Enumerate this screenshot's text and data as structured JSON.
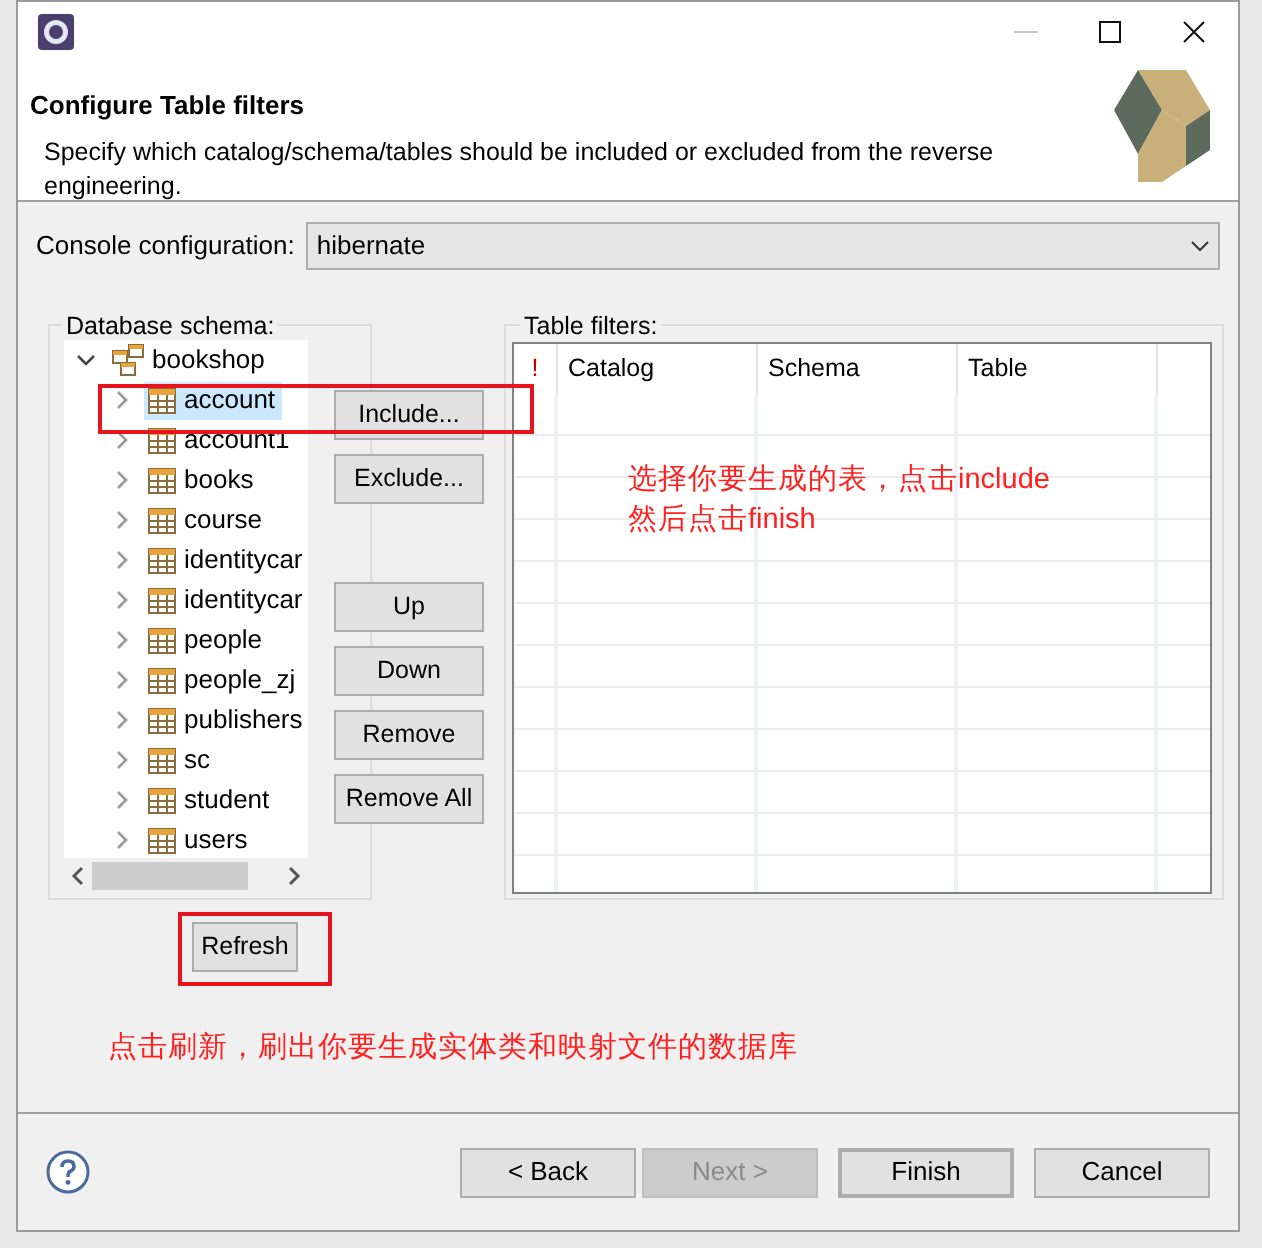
{
  "header": {
    "title": "Configure Table filters",
    "description": "Specify which catalog/schema/tables should be included or excluded from the reverse engineering."
  },
  "console_configuration": {
    "label": "Console configuration:",
    "value": "hibernate"
  },
  "database_schema": {
    "label": "Database schema:",
    "tree": [
      {
        "label": "bookshop",
        "kind": "schema",
        "expanded": true,
        "selected": false,
        "children": [
          {
            "label": "account",
            "kind": "table",
            "expanded": false,
            "selected": true
          },
          {
            "label": "account1",
            "kind": "table",
            "expanded": false,
            "selected": false
          },
          {
            "label": "books",
            "kind": "table",
            "expanded": false,
            "selected": false
          },
          {
            "label": "course",
            "kind": "table",
            "expanded": false,
            "selected": false
          },
          {
            "label": "identitycar",
            "kind": "table",
            "expanded": false,
            "selected": false
          },
          {
            "label": "identitycar",
            "kind": "table",
            "expanded": false,
            "selected": false
          },
          {
            "label": "people",
            "kind": "table",
            "expanded": false,
            "selected": false
          },
          {
            "label": "people_zj",
            "kind": "table",
            "expanded": false,
            "selected": false
          },
          {
            "label": "publishers",
            "kind": "table",
            "expanded": false,
            "selected": false
          },
          {
            "label": "sc",
            "kind": "table",
            "expanded": false,
            "selected": false
          },
          {
            "label": "student",
            "kind": "table",
            "expanded": false,
            "selected": false
          },
          {
            "label": "users",
            "kind": "table",
            "expanded": false,
            "selected": false
          }
        ]
      }
    ]
  },
  "side_button_groups": [
    [
      "Include...",
      "Exclude..."
    ],
    [
      "Up",
      "Down",
      "Remove",
      "Remove All"
    ]
  ],
  "table_filters": {
    "label": "Table filters:",
    "columns": [
      "!",
      "Catalog",
      "Schema",
      "Table"
    ]
  },
  "refresh_button": "Refresh",
  "annotations": [
    {
      "text": "选择你要生成的表，点击include\n然后点击finish"
    },
    {
      "text": "点击刷新，刷出你要生成实体类和映射文件的数据库"
    }
  ],
  "footer_buttons": [
    {
      "label": "< Back",
      "disabled": false,
      "default": false
    },
    {
      "label": "Next >",
      "disabled": true,
      "default": false
    },
    {
      "label": "Finish",
      "disabled": false,
      "default": true
    },
    {
      "label": "Cancel",
      "disabled": false,
      "default": false
    }
  ]
}
